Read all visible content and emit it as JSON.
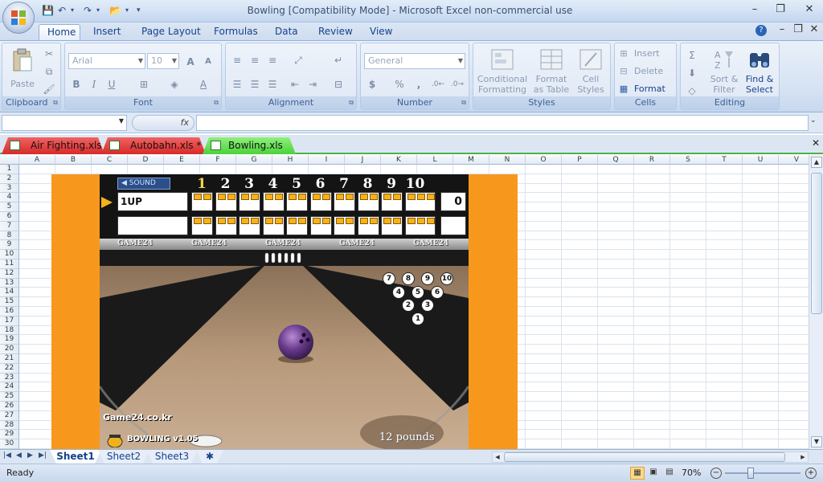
{
  "window": {
    "title": "Bowling  [Compatibility Mode] - Microsoft Excel non-commercial use",
    "minimize": "–",
    "restore": "❐",
    "close": "✕"
  },
  "ribbon_tabs": [
    "Home",
    "Insert",
    "Page Layout",
    "Formulas",
    "Data",
    "Review",
    "View"
  ],
  "ribbon": {
    "clipboard": {
      "label": "Clipboard",
      "paste": "Paste"
    },
    "font": {
      "label": "Font",
      "name": "Arial",
      "size": "10",
      "bold": "B",
      "italic": "I",
      "underline": "U"
    },
    "alignment": {
      "label": "Alignment"
    },
    "number": {
      "label": "Number",
      "format": "General",
      "currency": "$",
      "percent": "%",
      "comma": ","
    },
    "styles": {
      "label": "Styles",
      "conditional": "Conditional",
      "formatting": "Formatting",
      "format_as": "Format",
      "as_table": "as Table",
      "cell": "Cell",
      "cell_styles": "Styles"
    },
    "cells": {
      "label": "Cells",
      "insert": "Insert",
      "delete": "Delete",
      "format": "Format"
    },
    "editing": {
      "label": "Editing",
      "sort": "Sort &",
      "filter": "Filter",
      "find": "Find &",
      "select": "Select"
    }
  },
  "formula_bar": {
    "fx": "fx",
    "namebox": "",
    "content": ""
  },
  "workbooks": [
    {
      "name": "Air Fighting.xls",
      "active": false
    },
    {
      "name": "Autobahn.xls *",
      "active": false
    },
    {
      "name": "Bowling.xls",
      "active": true
    }
  ],
  "grid": {
    "columns": [
      "A",
      "B",
      "C",
      "D",
      "E",
      "F",
      "G",
      "H",
      "I",
      "J",
      "K",
      "L",
      "M",
      "N",
      "O",
      "P",
      "Q",
      "R",
      "S",
      "T",
      "U",
      "V"
    ],
    "rows": [
      "1",
      "2",
      "3",
      "4",
      "5",
      "6",
      "7",
      "8",
      "9",
      "10",
      "11",
      "12",
      "13",
      "14",
      "15",
      "16",
      "17",
      "18",
      "19",
      "20",
      "21",
      "22",
      "23",
      "24",
      "25",
      "26",
      "27",
      "28",
      "29",
      "30"
    ]
  },
  "game": {
    "sound_label": "SOUND",
    "frames": [
      "1",
      "2",
      "3",
      "4",
      "5",
      "6",
      "7",
      "8",
      "9",
      "10"
    ],
    "current_frame": 1,
    "player1": "1UP",
    "player2": "",
    "total1": "0",
    "banner_text": [
      "GAME24",
      "GAME24",
      "GAME24",
      "GAME24",
      "GAME24"
    ],
    "pins": [
      "7",
      "8",
      "9",
      "10",
      "4",
      "5",
      "6",
      "2",
      "3",
      "1"
    ],
    "brand": "Game24.co.kr",
    "version": "BOWLING v1.05",
    "weight": "12 pounds"
  },
  "sheets": [
    {
      "name": "Sheet1",
      "active": true
    },
    {
      "name": "Sheet2",
      "active": false
    },
    {
      "name": "Sheet3",
      "active": false
    }
  ],
  "status": {
    "ready": "Ready",
    "zoom": "70%"
  },
  "colors": {
    "accent": "#15428b",
    "orange": "#f7981d",
    "sheet_green": "#4bb24a"
  }
}
